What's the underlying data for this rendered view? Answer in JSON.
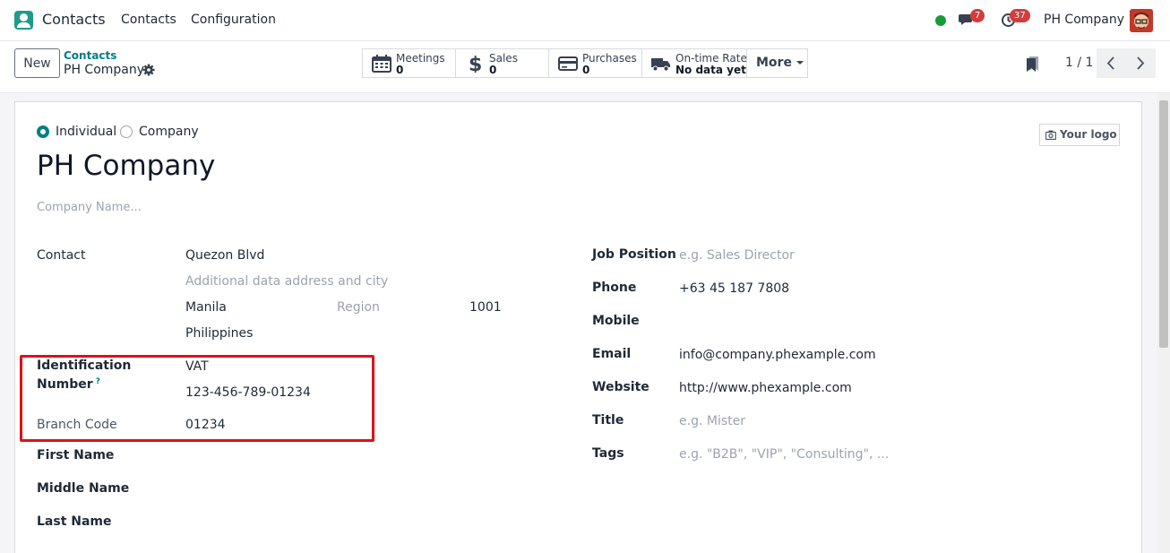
{
  "navbar": {
    "app_name": "Contacts",
    "menus": [
      "Contacts",
      "Configuration"
    ],
    "chat_badge": "7",
    "activity_badge": "37",
    "company": "PH Company",
    "colors": {
      "accent": "#017e84",
      "presence": "#179b3a",
      "badge": "#d23d3d"
    }
  },
  "control": {
    "new_label": "New",
    "breadcrumb_parent": "Contacts",
    "breadcrumb_current": "PH Company",
    "smart_buttons": [
      {
        "label": "Meetings",
        "value": "0",
        "icon": "calendar-icon"
      },
      {
        "label": "Sales",
        "value": "0",
        "icon": "dollar-icon"
      },
      {
        "label": "Purchases",
        "value": "0",
        "icon": "credit-card-icon"
      },
      {
        "label": "On-time Rate",
        "value": "No data yet",
        "icon": "truck-icon"
      }
    ],
    "more_label": "More",
    "pager": "1 / 1"
  },
  "form": {
    "type_options": [
      "Individual",
      "Company"
    ],
    "selected_type": "Individual",
    "logo_label": "Your logo",
    "name": "PH Company",
    "company_name_placeholder": "Company Name...",
    "contact_label": "Contact",
    "street": "Quezon Blvd",
    "street2_placeholder": "Additional data address and city",
    "city": "Manila",
    "state_placeholder": "Region",
    "zip": "1001",
    "country": "Philippines",
    "identification_label_1": "Identification",
    "identification_label_2": "Number",
    "help_mark": "?",
    "id_type": "VAT",
    "id_number": "123-456-789-01234",
    "branch_code_label": "Branch Code",
    "branch_code": "01234",
    "first_name_label": "First Name",
    "middle_name_label": "Middle Name",
    "last_name_label": "Last Name",
    "job_position_label": "Job Position",
    "job_position_placeholder": "e.g. Sales Director",
    "phone_label": "Phone",
    "phone": "+63 45 187 7808",
    "mobile_label": "Mobile",
    "email_label": "Email",
    "email": "info@company.phexample.com",
    "website_label": "Website",
    "website": "http://www.phexample.com",
    "title_label": "Title",
    "title_placeholder": "e.g. Mister",
    "tags_label": "Tags",
    "tags_placeholder": "e.g. \"B2B\", \"VIP\", \"Consulting\", ..."
  }
}
